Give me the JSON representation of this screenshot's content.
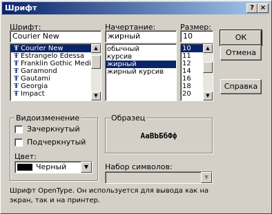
{
  "title": "Шрифт",
  "titlebar": {
    "help": "?",
    "close": "×"
  },
  "font": {
    "label": "Шрифт:",
    "value": "Courier New",
    "items": [
      {
        "name": "Courier New",
        "selected": true
      },
      {
        "name": "Estrangelo Edessa",
        "selected": false
      },
      {
        "name": "Franklin Gothic Mediu",
        "selected": false
      },
      {
        "name": "Garamond",
        "selected": false
      },
      {
        "name": "Gautami",
        "selected": false
      },
      {
        "name": "Georgia",
        "selected": false
      },
      {
        "name": "Impact",
        "selected": false
      }
    ]
  },
  "style": {
    "label": "Начертание:",
    "value": "жирный",
    "items": [
      {
        "name": "обычный",
        "selected": false
      },
      {
        "name": "курсив",
        "selected": false
      },
      {
        "name": "жирный",
        "selected": true
      },
      {
        "name": "жирный курсив",
        "selected": false
      }
    ]
  },
  "size": {
    "label": "Размер:",
    "value": "10",
    "items": [
      {
        "name": "10",
        "selected": true
      },
      {
        "name": "11",
        "selected": false
      },
      {
        "name": "12",
        "selected": false
      },
      {
        "name": "14",
        "selected": false
      },
      {
        "name": "16",
        "selected": false
      },
      {
        "name": "18",
        "selected": false
      },
      {
        "name": "20",
        "selected": false
      }
    ]
  },
  "buttons": {
    "ok": "ОК",
    "cancel": "Отмена",
    "help": "Справка"
  },
  "effects": {
    "title": "Видоизменение",
    "strikeout": "Зачеркнутый",
    "underline": "Подчеркнутый",
    "color_label": "Цвет:",
    "color_value": "Черный",
    "color_swatch": "#000000"
  },
  "sample": {
    "title": "Образец",
    "text": "AaBbБбФф"
  },
  "charset": {
    "label": "Набор символов:",
    "value": ""
  },
  "description": "Шрифт OpenType. Он используется для вывода как на экран, так и на принтер.",
  "colors": {
    "selection": "#0a246a",
    "face": "#d4d0c8"
  }
}
